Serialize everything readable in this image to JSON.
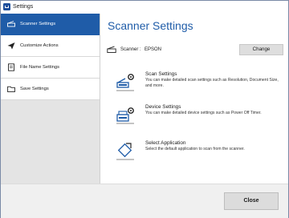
{
  "window": {
    "title": "Settings"
  },
  "sidebar": {
    "items": [
      {
        "label": "Scanner Settings",
        "icon": "scanner-icon",
        "active": true
      },
      {
        "label": "Customize Actions",
        "icon": "send-icon",
        "active": false
      },
      {
        "label": "File Name Settings",
        "icon": "file-icon",
        "active": false
      },
      {
        "label": "Save Settings",
        "icon": "folder-icon",
        "active": false
      }
    ]
  },
  "main": {
    "title": "Scanner Settings",
    "scanner_label": "Scanner :",
    "scanner_value": "EPSON",
    "change_label": "Change",
    "options": [
      {
        "title": "Scan Settings",
        "description": "You can make detailed scan settings such as Resolution, Document Size, and more.",
        "icon": "scan-settings-icon"
      },
      {
        "title": "Device Settings",
        "description": "You can make detailed device settings such as Power Off Timer.",
        "icon": "device-settings-icon"
      },
      {
        "title": "Select Application",
        "description": "Select the default application to scan from the scanner.",
        "icon": "select-application-icon"
      }
    ]
  },
  "footer": {
    "close_label": "Close"
  },
  "colors": {
    "accent": "#1f5ca8",
    "sidebar_bg": "#e4e4e4",
    "footer_bg": "#f0f0f0"
  }
}
